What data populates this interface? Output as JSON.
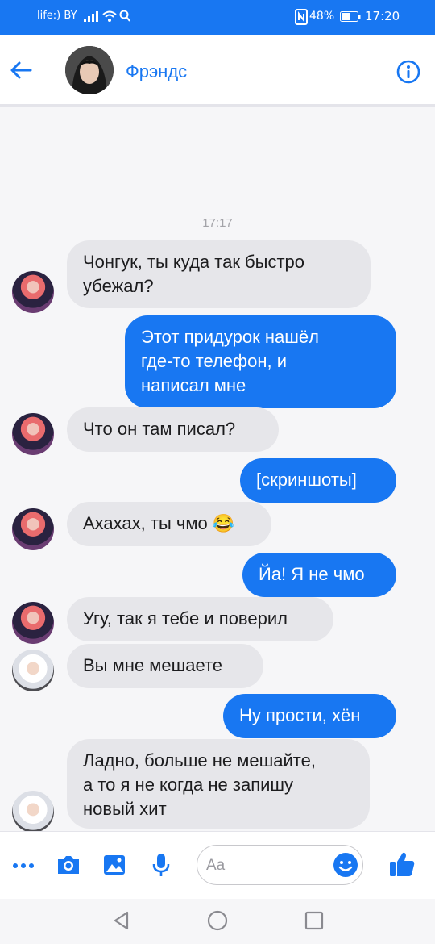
{
  "status_bar": {
    "carrier": "life:) BY",
    "battery": "48%",
    "time": "17:20",
    "icons": [
      "signal-icon",
      "wifi-icon",
      "search-icon",
      "nfc-icon",
      "battery-icon"
    ]
  },
  "header": {
    "title": "Фрэндс",
    "back_icon": "arrow-left-icon",
    "info_icon": "info-icon",
    "accent": "#1877f2"
  },
  "timestamp": "17:17",
  "messages": [
    {
      "direction": "incoming",
      "avatar": "red-hair",
      "lines": [
        "Чонгук, ты куда так быстро",
        "убежал?"
      ]
    },
    {
      "direction": "outgoing",
      "lines": [
        "Этот придурок нашёл",
        "где-то телефон, и",
        "написал мне"
      ]
    },
    {
      "direction": "incoming",
      "avatar": "red-hair",
      "lines": [
        "Что он там писал?"
      ]
    },
    {
      "direction": "outgoing",
      "lines": [
        "[скриншоты]"
      ]
    },
    {
      "direction": "incoming",
      "avatar": "red-hair",
      "lines": [
        "Ахахах, ты чмо 😂"
      ]
    },
    {
      "direction": "outgoing",
      "lines": [
        "Йа! Я не чмо"
      ]
    },
    {
      "direction": "incoming",
      "avatar": "red-hair",
      "lines": [
        "Угу, так я тебе и поверил"
      ]
    },
    {
      "direction": "incoming",
      "avatar": "white-hood",
      "lines": [
        "Вы мне мешаете"
      ]
    },
    {
      "direction": "outgoing",
      "lines": [
        "Ну прости, хён"
      ]
    },
    {
      "direction": "incoming",
      "avatar": "white-hood",
      "lines": [
        "Ладно, больше не мешайте,",
        "а то я не когда не запишу",
        "новый хит"
      ]
    }
  ],
  "composer": {
    "placeholder": "Aa",
    "icons": [
      "more-icon",
      "camera-icon",
      "image-icon",
      "microphone-icon",
      "emoji-icon",
      "thumbs-up-icon"
    ]
  },
  "nav": {
    "icons": [
      "back-triangle-icon",
      "home-circle-icon",
      "recents-square-icon"
    ]
  },
  "colors": {
    "outgoing_bubble": "#1877f2",
    "incoming_bubble": "#e6e6ea",
    "background": "#f6f6f8"
  }
}
